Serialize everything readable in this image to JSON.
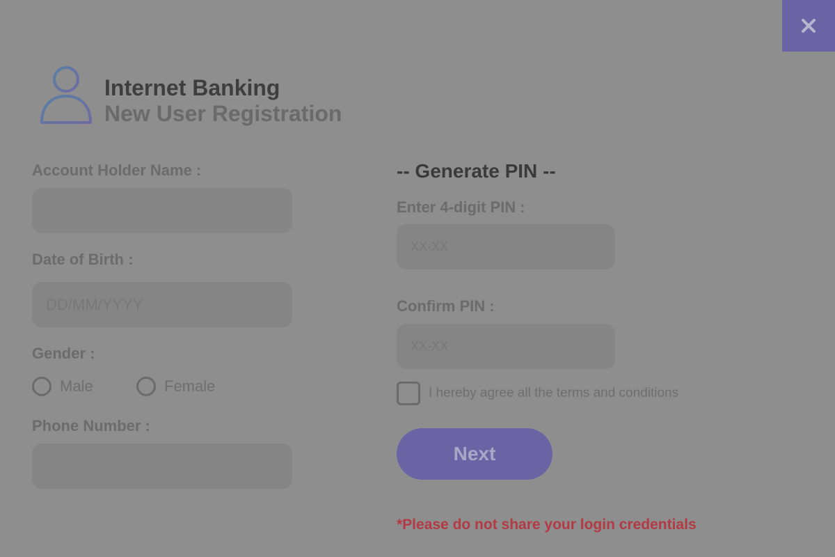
{
  "header": {
    "title": "Internet Banking",
    "subtitle": "New User Registration"
  },
  "close_label": "×",
  "left_form": {
    "account_holder_label": "Account Holder Name :",
    "account_holder_value": "",
    "dob_label": "Date of Birth :",
    "dob_placeholder": "DD/MM/YYYY",
    "gender_label": "Gender :",
    "gender_options": [
      "Male",
      "Female"
    ],
    "phone_label": "Phone Number :",
    "phone_value": ""
  },
  "right_form": {
    "section_title": "-- Generate PIN --",
    "pin_label": "Enter 4-digit PIN :",
    "pin_placeholder": "XX-XX",
    "confirm_pin_label": "Confirm PIN :",
    "confirm_pin_placeholder": "XX-XX",
    "terms_label": "I hereby agree all the terms and conditions",
    "terms_checked": false,
    "next_label": "Next",
    "warning": "*Please do not share your login credentials"
  },
  "colors": {
    "overlay_bg": "#8e8e8e",
    "accent": "#6a64a5",
    "warning": "#b33a44"
  },
  "icons": {
    "close": "close-icon",
    "user": "user-icon"
  }
}
